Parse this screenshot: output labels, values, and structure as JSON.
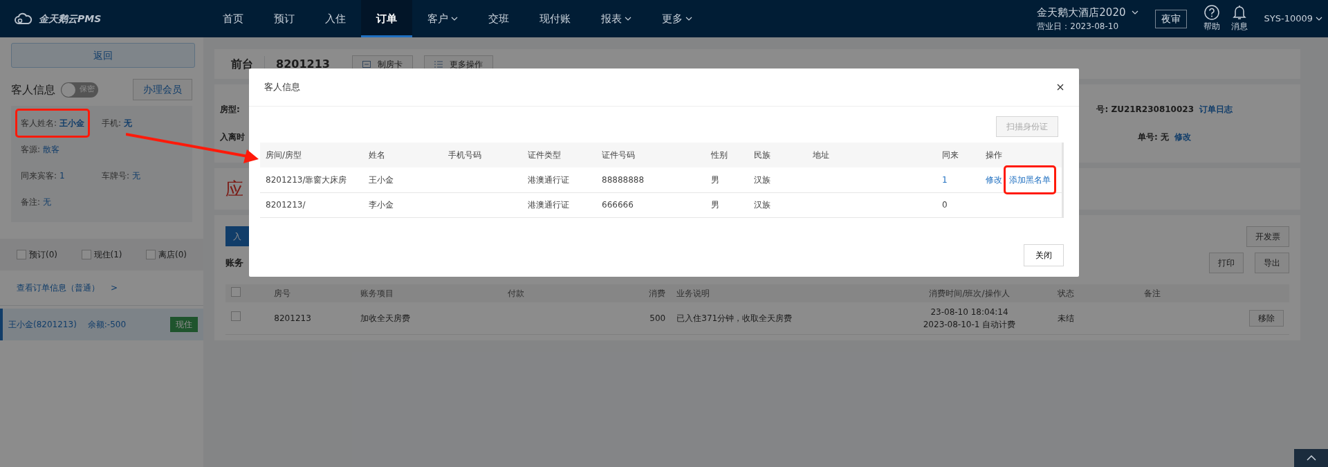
{
  "navbar": {
    "logo": "金天鹅云PMS",
    "items": [
      {
        "label": "首页",
        "selected": false,
        "dropdown": false
      },
      {
        "label": "预订",
        "selected": false,
        "dropdown": false
      },
      {
        "label": "入住",
        "selected": false,
        "dropdown": false
      },
      {
        "label": "订单",
        "selected": true,
        "dropdown": false
      },
      {
        "label": "客户",
        "selected": false,
        "dropdown": true
      },
      {
        "label": "交班",
        "selected": false,
        "dropdown": false
      },
      {
        "label": "现付账",
        "selected": false,
        "dropdown": false
      },
      {
        "label": "报表",
        "selected": false,
        "dropdown": true
      },
      {
        "label": "更多",
        "selected": false,
        "dropdown": true
      }
    ],
    "hotel": "金天鹅大酒店2020",
    "business_date": "营业日：2023-08-10",
    "night_audit": "夜审",
    "help": "帮助",
    "messages": "消息",
    "user": "SYS-10009"
  },
  "sidebar": {
    "back": "返回",
    "title": "客人信息",
    "privacy_toggle": {
      "label": "保密",
      "on": false
    },
    "member_button": "办理会员",
    "field_rows": [
      [
        {
          "label": "客人姓名:",
          "value": "王小金",
          "bold": true
        },
        {
          "label": "手机:",
          "value": "无",
          "bold": true
        }
      ],
      [
        {
          "label": "客源:",
          "value": "散客",
          "bold": false
        }
      ],
      [
        {
          "label": "同来宾客:",
          "value": "1",
          "bold": false
        },
        {
          "label": "车牌号:",
          "value": "无",
          "bold": false
        }
      ],
      [
        {
          "label": "备注:",
          "value": "无",
          "bold": false
        }
      ]
    ],
    "filters": [
      {
        "label": "预订(0)",
        "checked": false
      },
      {
        "label": "现住(1)",
        "checked": false
      },
      {
        "label": "离店(0)",
        "checked": false
      }
    ],
    "order_link": "查看订单信息（普通）",
    "order_link_arrow": ">",
    "guests": [
      {
        "name": "王小金(8201213)",
        "balance": "余额:-500",
        "status": "现住",
        "selected": true
      }
    ]
  },
  "order": {
    "title": "前台",
    "room": "8201213",
    "buttons": [
      {
        "label": "制房卡",
        "kind": "card"
      },
      {
        "label": "更多操作",
        "kind": "list"
      }
    ],
    "info": [
      {
        "left": "房型:",
        "label": "号:",
        "value": "ZU21R230810023",
        "link": "订单日志"
      },
      {
        "left": "入离时",
        "label": "单号:",
        "value": "无",
        "link": "修改"
      }
    ],
    "receivable": "应",
    "bills": {
      "select_all_checked": false,
      "add_button": "入",
      "invoice_button": "开发票",
      "title": "账务",
      "actions": [
        "打印",
        "导出"
      ],
      "columns": [
        "房号",
        "账务项目",
        "付款",
        "消费",
        "业务说明",
        "消费时间/班次/操作人",
        "状态",
        "备注"
      ],
      "rows": [
        {
          "checked": false,
          "cells": [
            "8201213",
            "加收全天房费",
            null,
            "500",
            "已入住371分钟，收取全天房费",
            [
              "23-08-10 18:04:14",
              "2023-08-10-1 自动计费"
            ],
            "未结",
            null
          ],
          "action": "移除"
        }
      ]
    }
  },
  "modal": {
    "title": "客人信息",
    "scan_button": {
      "label": "扫描身份证",
      "disabled": true
    },
    "columns": [
      "房间/房型",
      "姓名",
      "手机号码",
      "证件类型",
      "证件号码",
      "性别",
      "民族",
      "地址",
      "同来",
      "操作"
    ],
    "rows": [
      {
        "room": "8201213/靠窗大床房",
        "name": "王小金",
        "id_type": "港澳通行证",
        "id_number": "88888888",
        "gender": "男",
        "ethnicity": "汉族",
        "companions": "1",
        "companions_link": true,
        "actions": [
          "修改",
          "添加黑名单"
        ]
      },
      {
        "room": "8201213/",
        "name": "李小金",
        "id_type": "港澳通行证",
        "id_number": "666666",
        "gender": "男",
        "ethnicity": "汉族",
        "companions": "0",
        "companions_link": false
      }
    ],
    "close_button": "关闭"
  },
  "annotations": [
    {
      "kind": "box"
    },
    {
      "kind": "arrow"
    },
    {
      "kind": "box"
    }
  ]
}
